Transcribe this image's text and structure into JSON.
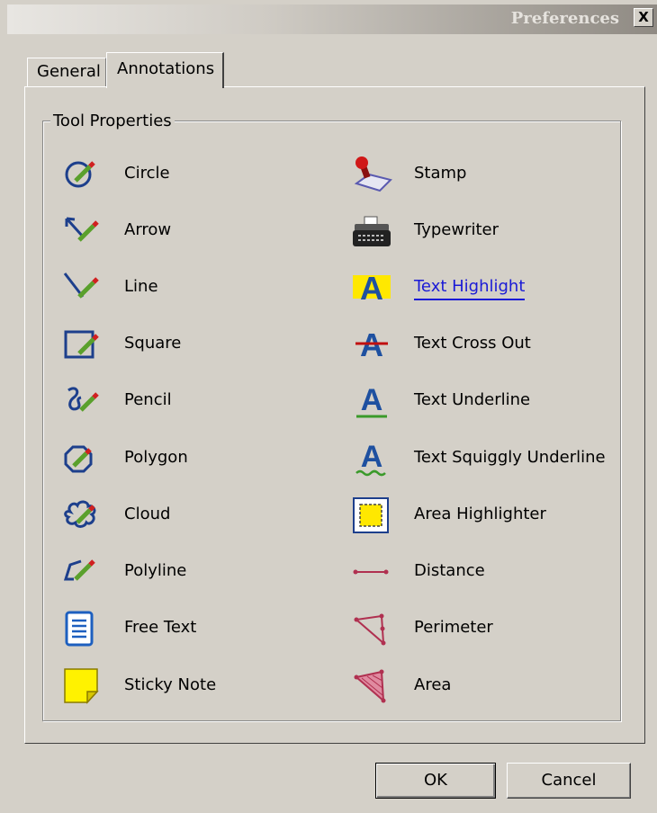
{
  "window": {
    "title": "Preferences",
    "close_label": "X"
  },
  "tabs": [
    {
      "label": "General",
      "active": false
    },
    {
      "label": "Annotations",
      "active": true
    }
  ],
  "group": {
    "title": "Tool Properties"
  },
  "tools_left": [
    {
      "label": "Circle",
      "icon": "circle-icon"
    },
    {
      "label": "Arrow",
      "icon": "arrow-icon"
    },
    {
      "label": "Line",
      "icon": "line-icon"
    },
    {
      "label": "Square",
      "icon": "square-icon"
    },
    {
      "label": "Pencil",
      "icon": "pencil-icon"
    },
    {
      "label": "Polygon",
      "icon": "polygon-icon"
    },
    {
      "label": "Cloud",
      "icon": "cloud-icon"
    },
    {
      "label": "Polyline",
      "icon": "polyline-icon"
    },
    {
      "label": "Free Text",
      "icon": "free-text-icon"
    },
    {
      "label": "Sticky Note",
      "icon": "sticky-note-icon"
    }
  ],
  "tools_right": [
    {
      "label": "Stamp",
      "icon": "stamp-icon"
    },
    {
      "label": "Typewriter",
      "icon": "typewriter-icon"
    },
    {
      "label": "Text Highlight",
      "icon": "text-highlight-icon",
      "selected": true
    },
    {
      "label": "Text Cross Out",
      "icon": "text-cross-out-icon"
    },
    {
      "label": "Text Underline",
      "icon": "text-underline-icon"
    },
    {
      "label": "Text Squiggly Underline",
      "icon": "text-squiggly-underline-icon"
    },
    {
      "label": "Area Highlighter",
      "icon": "area-highlighter-icon"
    },
    {
      "label": "Distance",
      "icon": "distance-icon"
    },
    {
      "label": "Perimeter",
      "icon": "perimeter-icon"
    },
    {
      "label": "Area",
      "icon": "area-icon"
    }
  ],
  "buttons": {
    "ok": "OK",
    "cancel": "Cancel"
  },
  "colors": {
    "selected_link": "#1a1ad6",
    "dialog_bg": "#d4d0c8"
  }
}
